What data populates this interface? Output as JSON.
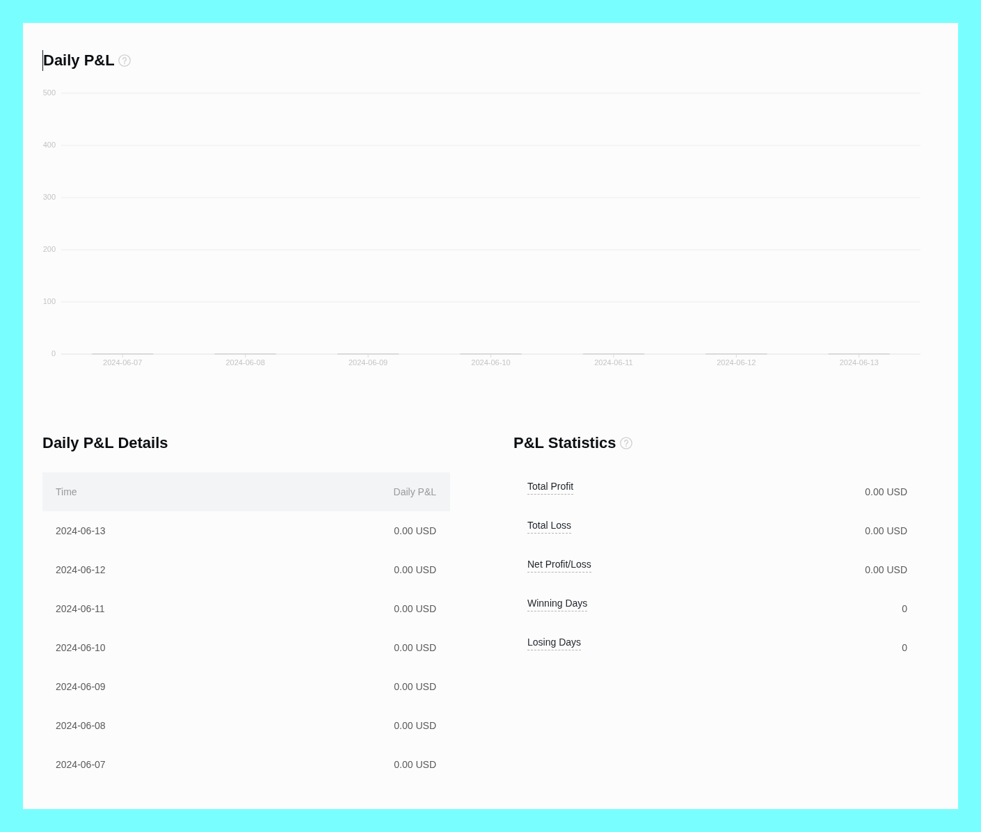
{
  "daily_pnl": {
    "title": "Daily P&L",
    "chart_data": {
      "type": "bar",
      "categories": [
        "2024-06-07",
        "2024-06-08",
        "2024-06-09",
        "2024-06-10",
        "2024-06-11",
        "2024-06-12",
        "2024-06-13"
      ],
      "values": [
        0,
        0,
        0,
        0,
        0,
        0,
        0
      ],
      "ylim": [
        0,
        500
      ],
      "yticks": [
        0,
        100,
        200,
        300,
        400,
        500
      ],
      "grid": true
    }
  },
  "details": {
    "title": "Daily P&L Details",
    "columns": [
      "Time",
      "Daily P&L"
    ],
    "rows": [
      [
        "2024-06-13",
        "0.00 USD"
      ],
      [
        "2024-06-12",
        "0.00 USD"
      ],
      [
        "2024-06-11",
        "0.00 USD"
      ],
      [
        "2024-06-10",
        "0.00 USD"
      ],
      [
        "2024-06-09",
        "0.00 USD"
      ],
      [
        "2024-06-08",
        "0.00 USD"
      ],
      [
        "2024-06-07",
        "0.00 USD"
      ]
    ]
  },
  "statistics": {
    "title": "P&L Statistics",
    "items": [
      {
        "label": "Total Profit",
        "value": "0.00 USD"
      },
      {
        "label": "Total Loss",
        "value": "0.00 USD"
      },
      {
        "label": "Net Profit/Loss",
        "value": "0.00 USD"
      },
      {
        "label": "Winning Days",
        "value": "0"
      },
      {
        "label": "Losing Days",
        "value": "0"
      }
    ]
  }
}
